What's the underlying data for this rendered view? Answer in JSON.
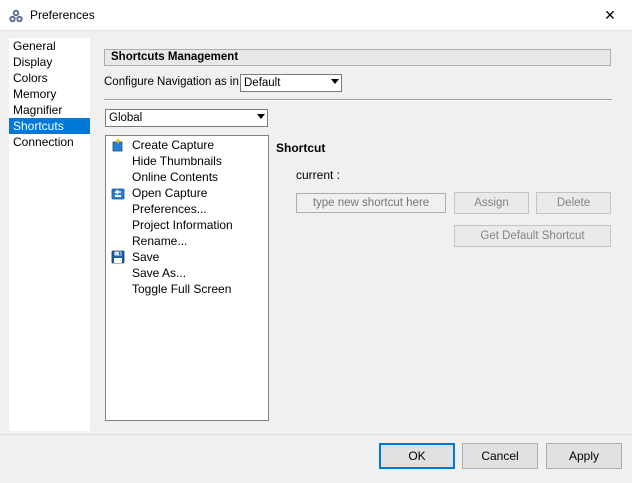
{
  "window": {
    "title": "Preferences",
    "close_glyph": "✕"
  },
  "sidebar": {
    "items": [
      {
        "label": "General",
        "selected": false
      },
      {
        "label": "Display",
        "selected": false
      },
      {
        "label": "Colors",
        "selected": false
      },
      {
        "label": "Memory",
        "selected": false
      },
      {
        "label": "Magnifier",
        "selected": false
      },
      {
        "label": "Shortcuts",
        "selected": true
      },
      {
        "label": "Connection",
        "selected": false
      }
    ]
  },
  "main": {
    "section_title": "Shortcuts Management",
    "nav_label": "Configure Navigation as in",
    "nav_value": "Default",
    "scope_value": "Global",
    "commands": [
      {
        "label": "Create Capture",
        "icon": "create-capture-icon"
      },
      {
        "label": "Hide Thumbnails",
        "icon": ""
      },
      {
        "label": "Online Contents",
        "icon": ""
      },
      {
        "label": "Open Capture",
        "icon": "open-capture-icon"
      },
      {
        "label": "Preferences...",
        "icon": ""
      },
      {
        "label": "Project Information",
        "icon": ""
      },
      {
        "label": "Rename...",
        "icon": ""
      },
      {
        "label": "Save",
        "icon": "floppy-disk-icon"
      },
      {
        "label": "Save As...",
        "icon": ""
      },
      {
        "label": "Toggle Full Screen",
        "icon": ""
      }
    ],
    "shortcut": {
      "title": "Shortcut",
      "current_label": "current :",
      "input_placeholder": "type new shortcut here",
      "assign_label": "Assign",
      "delete_label": "Delete",
      "default_label": "Get Default Shortcut"
    }
  },
  "footer": {
    "ok_label": "OK",
    "cancel_label": "Cancel",
    "apply_label": "Apply"
  },
  "colors": {
    "selection": "#0078d7"
  }
}
